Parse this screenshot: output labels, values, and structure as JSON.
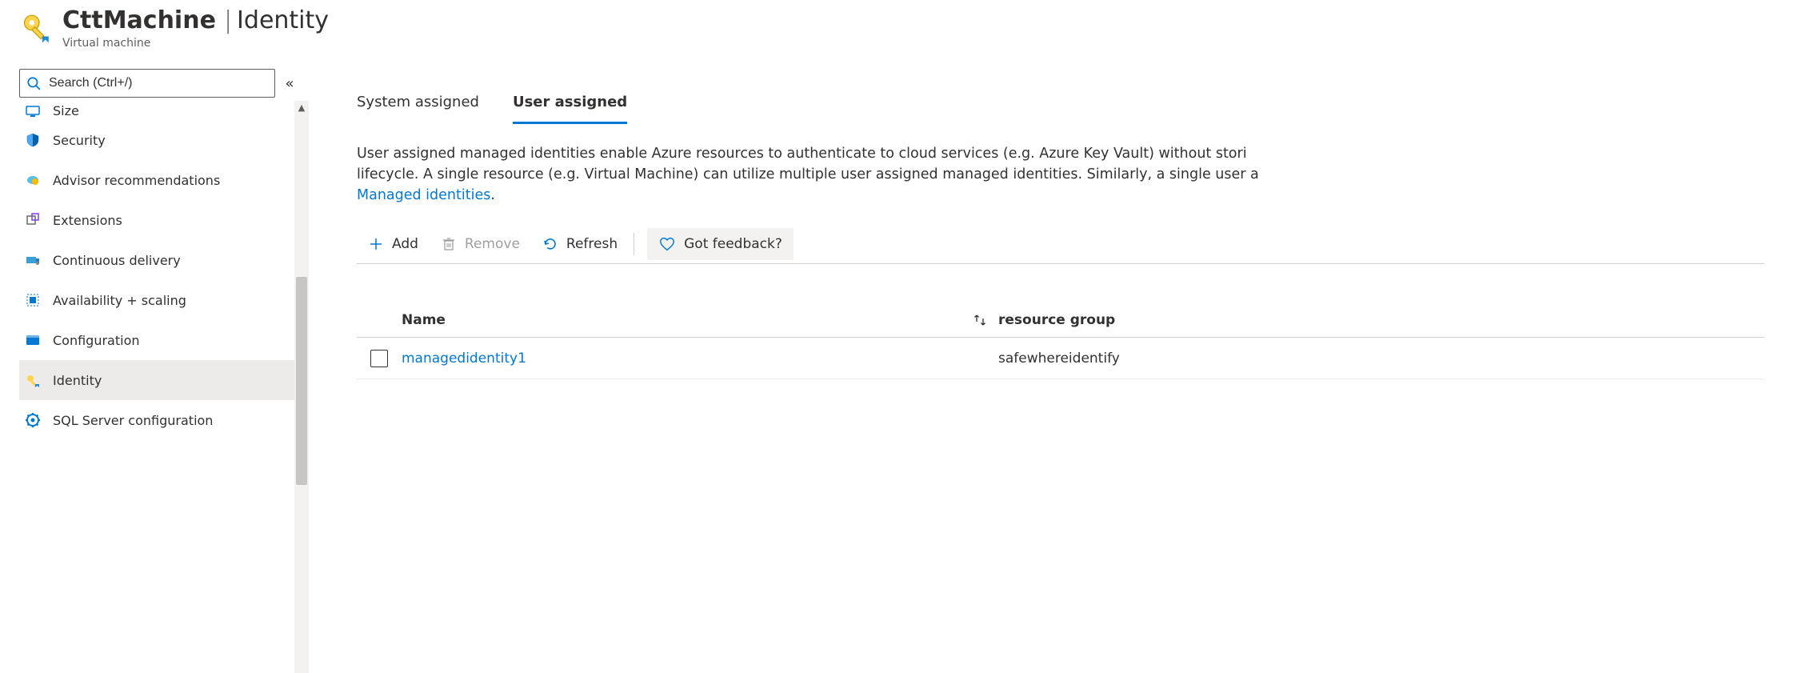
{
  "header": {
    "resource_name": "CttMachine",
    "divider": "|",
    "section": "Identity",
    "subtitle": "Virtual machine"
  },
  "sidebar": {
    "search_placeholder": "Search (Ctrl+/)",
    "items": [
      {
        "label": "Size"
      },
      {
        "label": "Security"
      },
      {
        "label": "Advisor recommendations"
      },
      {
        "label": "Extensions"
      },
      {
        "label": "Continuous delivery"
      },
      {
        "label": "Availability + scaling"
      },
      {
        "label": "Configuration"
      },
      {
        "label": "Identity"
      },
      {
        "label": "SQL Server configuration"
      }
    ]
  },
  "tabs": {
    "system_assigned": "System assigned",
    "user_assigned": "User assigned"
  },
  "description": {
    "line1a": "User assigned managed identities enable Azure resources to authenticate to cloud services (e.g. Azure Key Vault) without stori",
    "line2a": "lifecycle. A single resource (e.g. Virtual Machine) can utilize multiple user assigned managed identities. Similarly, a single user a",
    "link": "Managed identities",
    "period": "."
  },
  "toolbar": {
    "add": "Add",
    "remove": "Remove",
    "refresh": "Refresh",
    "feedback": "Got feedback?"
  },
  "grid": {
    "columns": {
      "name": "Name",
      "resource_group": "resource group"
    },
    "rows": [
      {
        "name": "managedidentity1",
        "resource_group": "safewhereidentify"
      }
    ]
  }
}
